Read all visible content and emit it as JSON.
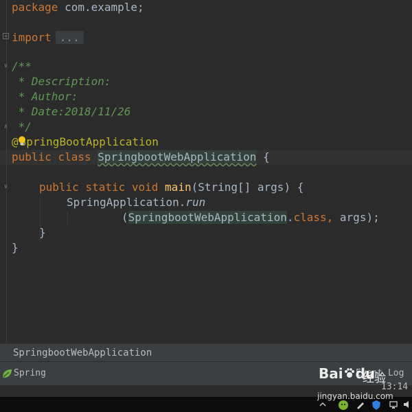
{
  "editor": {
    "lines": {
      "l1": {
        "kw": "package",
        "rest": " com.example;"
      },
      "l2": {
        "kw": "import",
        "fold": "..."
      },
      "l3": "/**",
      "l4": " * Description:",
      "l5": " * Author:",
      "l6": " * Date:2018/11/26",
      "l7": " */",
      "l8": {
        "at": "@",
        "name": "SpringBootApplication"
      },
      "l9": {
        "kw1": "public",
        "kw2": "class",
        "cls": "SpringbootWebApplication",
        "brace": "{"
      },
      "l10": {
        "kw1": "public",
        "kw2": "static",
        "kw3": "void",
        "method": "main",
        "params": "(String[] args) {"
      },
      "l11": {
        "recv": "SpringApplication.",
        "call": "run"
      },
      "l12": {
        "open": "(",
        "cls": "SpringbootWebApplication",
        "dot": ".",
        "kw": "class",
        "rest": ", args);"
      },
      "l13": "}",
      "l14": "}"
    }
  },
  "breadcrumb": {
    "label": "SpringbootWebApplication"
  },
  "statusbar": {
    "spring_label": "Spring",
    "event_log_label": "Event Log",
    "position": "13:14"
  },
  "watermark": {
    "brand": "Bai",
    "brand2": "du",
    "jingyan": "经验",
    "url": "jingyan.baidu.com"
  },
  "colors": {
    "background": "#2b2b2b",
    "keyword": "#cc7832",
    "comment": "#629755",
    "annotation": "#bbb529",
    "method": "#ffc66d",
    "text": "#a9b7c6"
  }
}
